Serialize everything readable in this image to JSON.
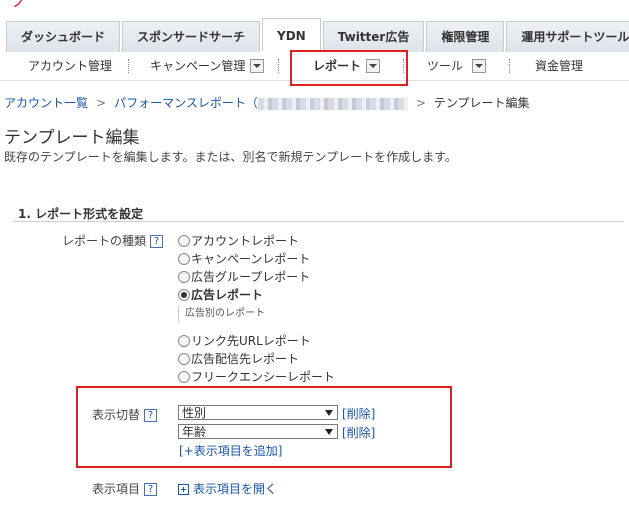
{
  "tabs": [
    {
      "label": "ダッシュボード"
    },
    {
      "label": "スポンサードサーチ"
    },
    {
      "label": "YDN"
    },
    {
      "label": "Twitter広告"
    },
    {
      "label": "権限管理"
    },
    {
      "label": "運用サポートツール"
    }
  ],
  "subnav": {
    "account": "アカウント管理",
    "campaign": "キャンペーン管理",
    "report": "レポート",
    "tools": "ツール",
    "funds": "資金管理"
  },
  "breadcrumb": {
    "account_list": "アカウント一覧",
    "performance": "パフォーマンスレポート（",
    "current": "テンプレート編集"
  },
  "page": {
    "title": "テンプレート編集",
    "description": "既存のテンプレートを編集します。または、別名で新規テンプレートを作成します。"
  },
  "section": {
    "title": "1. レポート形式を設定"
  },
  "report_type": {
    "label": "レポートの種類",
    "help": "?",
    "options": [
      "アカウントレポート",
      "キャンペーンレポート",
      "広告グループレポート",
      "広告レポート",
      "リンク先URLレポート",
      "広告配信先レポート",
      "フリークエンシーレポート"
    ],
    "selected": "広告レポート",
    "selected_note": "広告別のレポート"
  },
  "display_switch": {
    "label": "表示切替",
    "help": "?",
    "selects": [
      "性別",
      "年齢"
    ],
    "delete_label": "[削除]",
    "add_label": "[+表示項目を追加]"
  },
  "display_items": {
    "label": "表示項目",
    "help": "?",
    "expand_label": "表示項目を開く"
  }
}
